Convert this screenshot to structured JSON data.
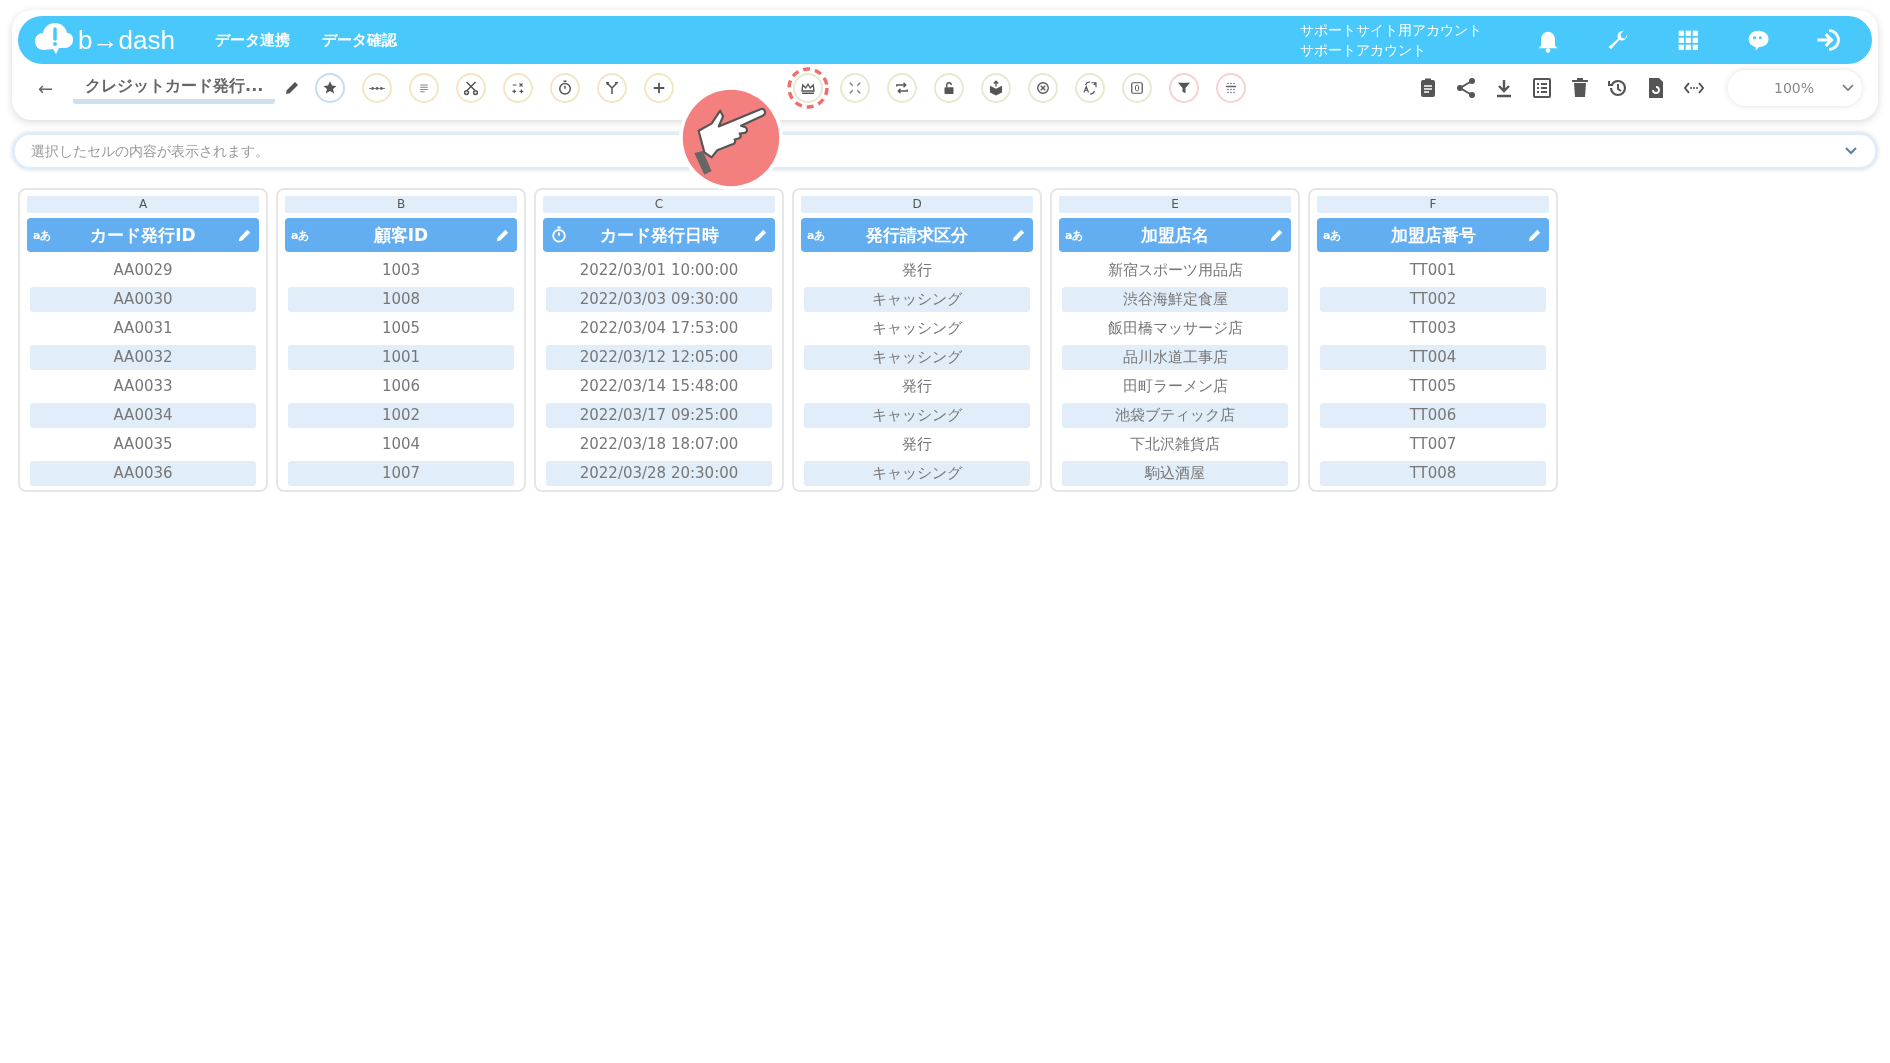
{
  "header": {
    "logo_text": "b→dash",
    "nav": [
      "データ連携",
      "データ確認"
    ],
    "account_lines": [
      "サポートサイト用アカウント",
      "サポートアカウント"
    ]
  },
  "toolbar": {
    "back": "←",
    "title": "クレジットカード発行...",
    "zoom": "100%"
  },
  "cell_bar": {
    "placeholder": "選択したセルの内容が表示されます。"
  },
  "columns": [
    {
      "letter": "A",
      "kind": "text",
      "type_label": "aあ",
      "name": "カード発行ID",
      "cells": [
        "AA0029",
        "AA0030",
        "AA0031",
        "AA0032",
        "AA0033",
        "AA0034",
        "AA0035",
        "AA0036"
      ]
    },
    {
      "letter": "B",
      "kind": "text",
      "type_label": "aあ",
      "name": "顧客ID",
      "cells": [
        "1003",
        "1008",
        "1005",
        "1001",
        "1006",
        "1002",
        "1004",
        "1007"
      ]
    },
    {
      "letter": "C",
      "kind": "datetime",
      "name": "カード発行日時",
      "cells": [
        "2022/03/01 10:00:00",
        "2022/03/03 09:30:00",
        "2022/03/04 17:53:00",
        "2022/03/12 12:05:00",
        "2022/03/14 15:48:00",
        "2022/03/17 09:25:00",
        "2022/03/18 18:07:00",
        "2022/03/28 20:30:00"
      ]
    },
    {
      "letter": "D",
      "kind": "text",
      "type_label": "aあ",
      "name": "発行請求区分",
      "cells": [
        "発行",
        "キャッシング",
        "キャッシング",
        "キャッシング",
        "発行",
        "キャッシング",
        "発行",
        "キャッシング"
      ]
    },
    {
      "letter": "E",
      "kind": "text",
      "type_label": "aあ",
      "name": "加盟店名",
      "cells": [
        "新宿スポーツ用品店",
        "渋谷海鮮定食屋",
        "飯田橋マッサージ店",
        "品川水道工事店",
        "田町ラーメン店",
        "池袋ブティック店",
        "下北沢雑貨店",
        "駒込酒屋"
      ]
    },
    {
      "letter": "F",
      "kind": "text",
      "type_label": "aあ",
      "name": "加盟店番号",
      "cells": [
        "TT001",
        "TT002",
        "TT003",
        "TT004",
        "TT005",
        "TT006",
        "TT007",
        "TT008"
      ]
    }
  ]
}
